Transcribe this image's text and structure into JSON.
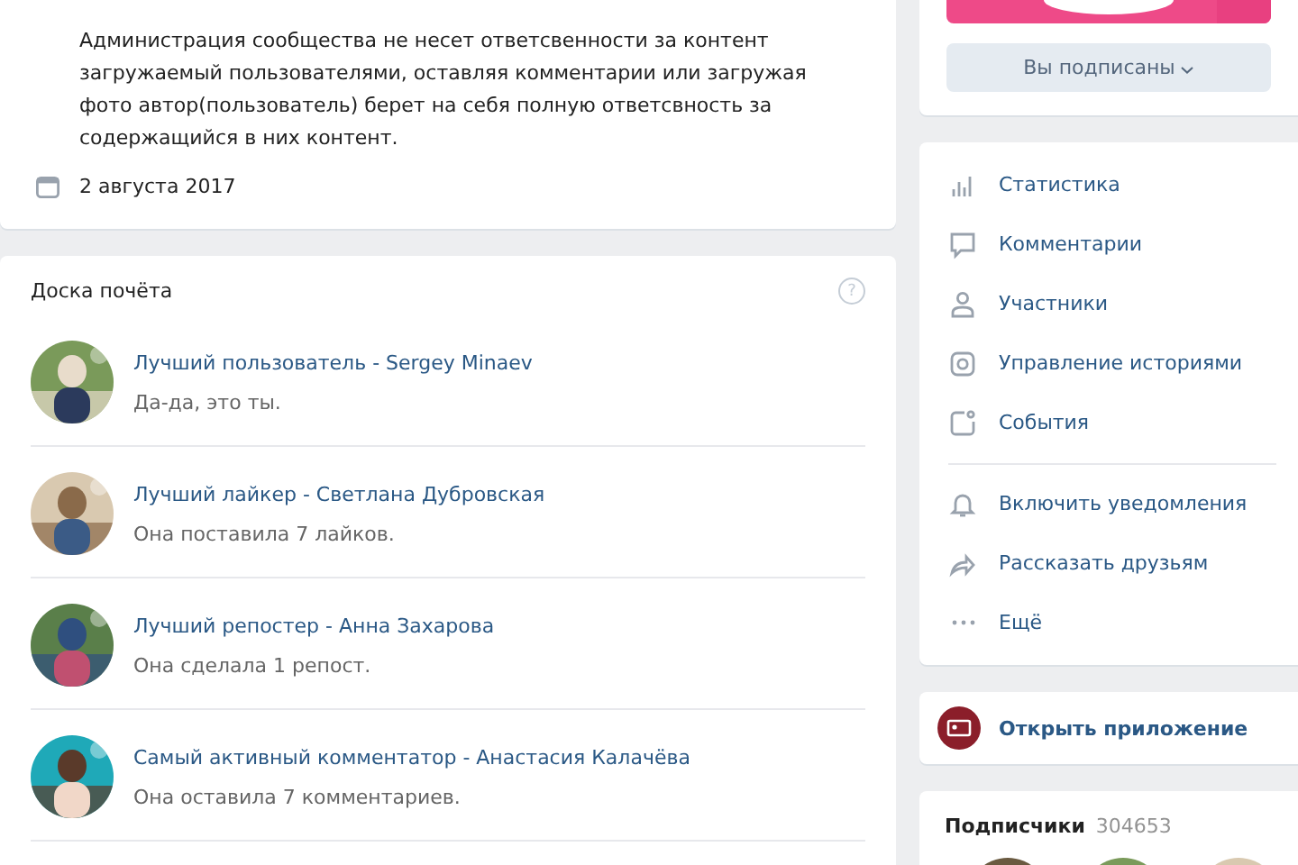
{
  "about": {
    "text": "Администрация сообщества не несет ответсвенности за контент загружаемый пользователями, оставляя комментарии или загружая фото автор(пользователь) берет на себя полную ответсвность за содержащийся в них контент.",
    "date": "2 августа 2017"
  },
  "honor_board": {
    "title": "Доска почёта",
    "help": "?",
    "entries": [
      {
        "title": "Лучший пользователь - Sergey Minaev",
        "note": "Да-да, это ты.",
        "kind": "picture"
      },
      {
        "title": "Лучший лайкер - Светлана Дубровская",
        "note": "Она поставила 7 лайков.",
        "kind": "picture"
      },
      {
        "title": "Лучший репостер - Анна Захарова",
        "note": "Она сделала 1 репост.",
        "kind": "picture"
      },
      {
        "title": "Самый активный комментатор - Анастасия Калачёва",
        "note": "Она оставила 7 комментариев.",
        "kind": "picture"
      }
    ]
  },
  "subscribe_button": "Вы подписаны",
  "menu_groups": [
    [
      {
        "label": "Статистика",
        "kind": "stats"
      },
      {
        "label": "Комментарии",
        "kind": "comments"
      },
      {
        "label": "Участники",
        "kind": "members"
      },
      {
        "label": "Управление историями",
        "kind": "stories"
      },
      {
        "label": "События",
        "kind": "events"
      }
    ],
    [
      {
        "label": "Включить уведомления",
        "kind": "bell"
      },
      {
        "label": "Рассказать друзьям",
        "kind": "share"
      },
      {
        "label": "Ещё",
        "kind": "more"
      }
    ]
  ],
  "app_link": "Открыть приложение",
  "subscribers": {
    "title": "Подписчики",
    "count": "304653"
  }
}
